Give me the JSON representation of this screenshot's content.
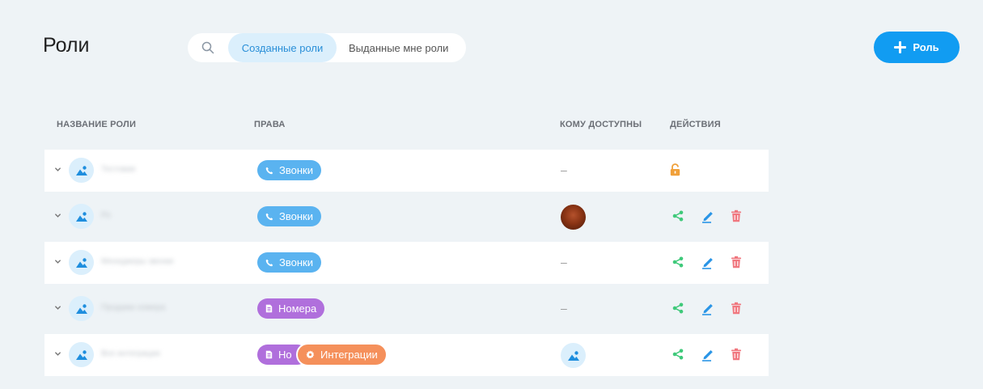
{
  "page": {
    "title": "Роли"
  },
  "filter": {
    "tabs": [
      {
        "label": "Созданные роли"
      },
      {
        "label": "Выданные мне роли"
      }
    ],
    "active_tab": "Созданные роли"
  },
  "toolbar": {
    "add_label": "Роль"
  },
  "table": {
    "headers": {
      "name": "НАЗВАНИЕ РОЛИ",
      "rights": "ПРАВА",
      "access": "КОМУ ДОСТУПНЫ",
      "actions": "ДЕЙСТВИЯ"
    },
    "rows": [
      {
        "name": "Тестовая",
        "rights": [
          {
            "label": "Звонки",
            "icon": "phone-icon"
          }
        ],
        "access": "–",
        "actions": [
          "lock-icon"
        ]
      },
      {
        "name": "Ро",
        "rights": [
          {
            "label": "Звонки",
            "icon": "phone-icon"
          }
        ],
        "access": "avatar-photo",
        "actions": [
          "share-icon",
          "edit-icon",
          "delete-icon"
        ]
      },
      {
        "name": "Менеджеры звонки",
        "rights": [
          {
            "label": "Звонки",
            "icon": "phone-icon"
          }
        ],
        "access": "–",
        "actions": [
          "share-icon",
          "edit-icon",
          "delete-icon"
        ]
      },
      {
        "name": "Продажи номера",
        "rights": [
          {
            "label": "Номера",
            "icon": "sim-icon"
          }
        ],
        "access": "–",
        "actions": [
          "share-icon",
          "edit-icon",
          "delete-icon"
        ]
      },
      {
        "name": "Все интеграции",
        "rights": [
          {
            "label": "Номера",
            "short": "Но",
            "icon": "sim-icon"
          },
          {
            "label": "Интеграции",
            "icon": "gear-icon"
          }
        ],
        "access": "avatar-icon",
        "actions": [
          "share-icon",
          "edit-icon",
          "delete-icon"
        ]
      }
    ]
  },
  "colors": {
    "accent": "#119cf2",
    "pill_blue": "#5ab3f0",
    "pill_purple": "#b06fdc",
    "pill_orange": "#f5905b",
    "share": "#3fc97a",
    "edit": "#2a95e6",
    "delete": "#f0777f",
    "lock": "#f0a03a"
  }
}
